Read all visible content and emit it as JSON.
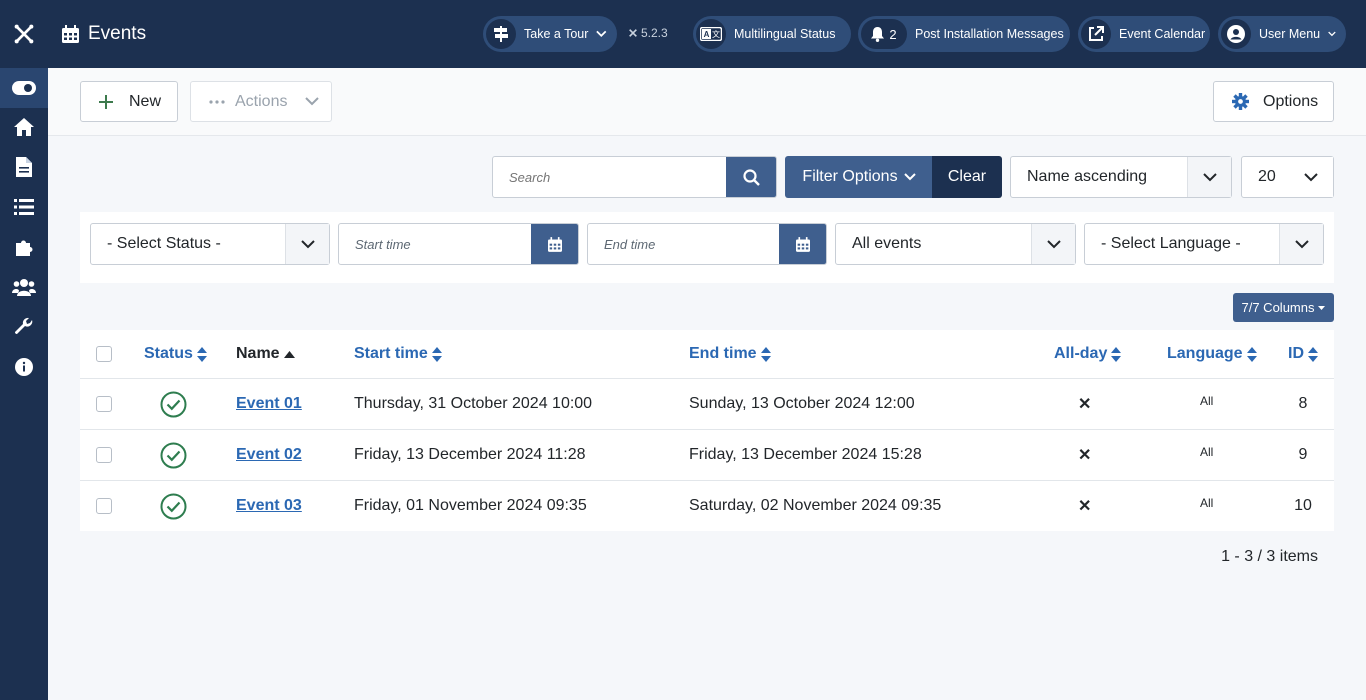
{
  "header": {
    "title": "Events",
    "tour_label": "Take a Tour",
    "version": "5.2.3",
    "multilingual_label": "Multilingual Status",
    "post_install_count": "2",
    "post_install_label": "Post Installation Messages",
    "event_calendar_label": "Event Calendar",
    "user_menu_label": "User Menu"
  },
  "toolbar": {
    "new_label": "New",
    "actions_label": "Actions",
    "options_label": "Options"
  },
  "search": {
    "placeholder": "Search"
  },
  "filter": {
    "filter_options_label": "Filter Options",
    "clear_label": "Clear",
    "sort_value": "Name ascending",
    "limit_value": "20",
    "status_value": "- Select Status -",
    "start_placeholder": "Start time",
    "end_placeholder": "End time",
    "events_value": "All events",
    "language_value": "- Select Language -"
  },
  "columns_button": "7/7 Columns",
  "table": {
    "headers": {
      "status": "Status",
      "name": "Name",
      "start": "Start time",
      "end": "End time",
      "allday": "All-day",
      "language": "Language",
      "id": "ID"
    },
    "rows": [
      {
        "name": "Event 01",
        "start": "Thursday, 31 October 2024 10:00",
        "end": "Sunday, 13 October 2024 12:00",
        "allday": "✕",
        "language": "All",
        "id": "8"
      },
      {
        "name": "Event 02",
        "start": "Friday, 13 December 2024 11:28",
        "end": "Friday, 13 December 2024 15:28",
        "allday": "✕",
        "language": "All",
        "id": "9"
      },
      {
        "name": "Event 03",
        "start": "Friday, 01 November 2024 09:35",
        "end": "Saturday, 02 November 2024 09:35",
        "allday": "✕",
        "language": "All",
        "id": "10"
      }
    ]
  },
  "pagination": {
    "info": "1 - 3 / 3 items"
  },
  "colors": {
    "sidebar": "#1c3050",
    "accent": "#3f5f8e",
    "link": "#2b68b3",
    "published": "#2e7d4f"
  }
}
